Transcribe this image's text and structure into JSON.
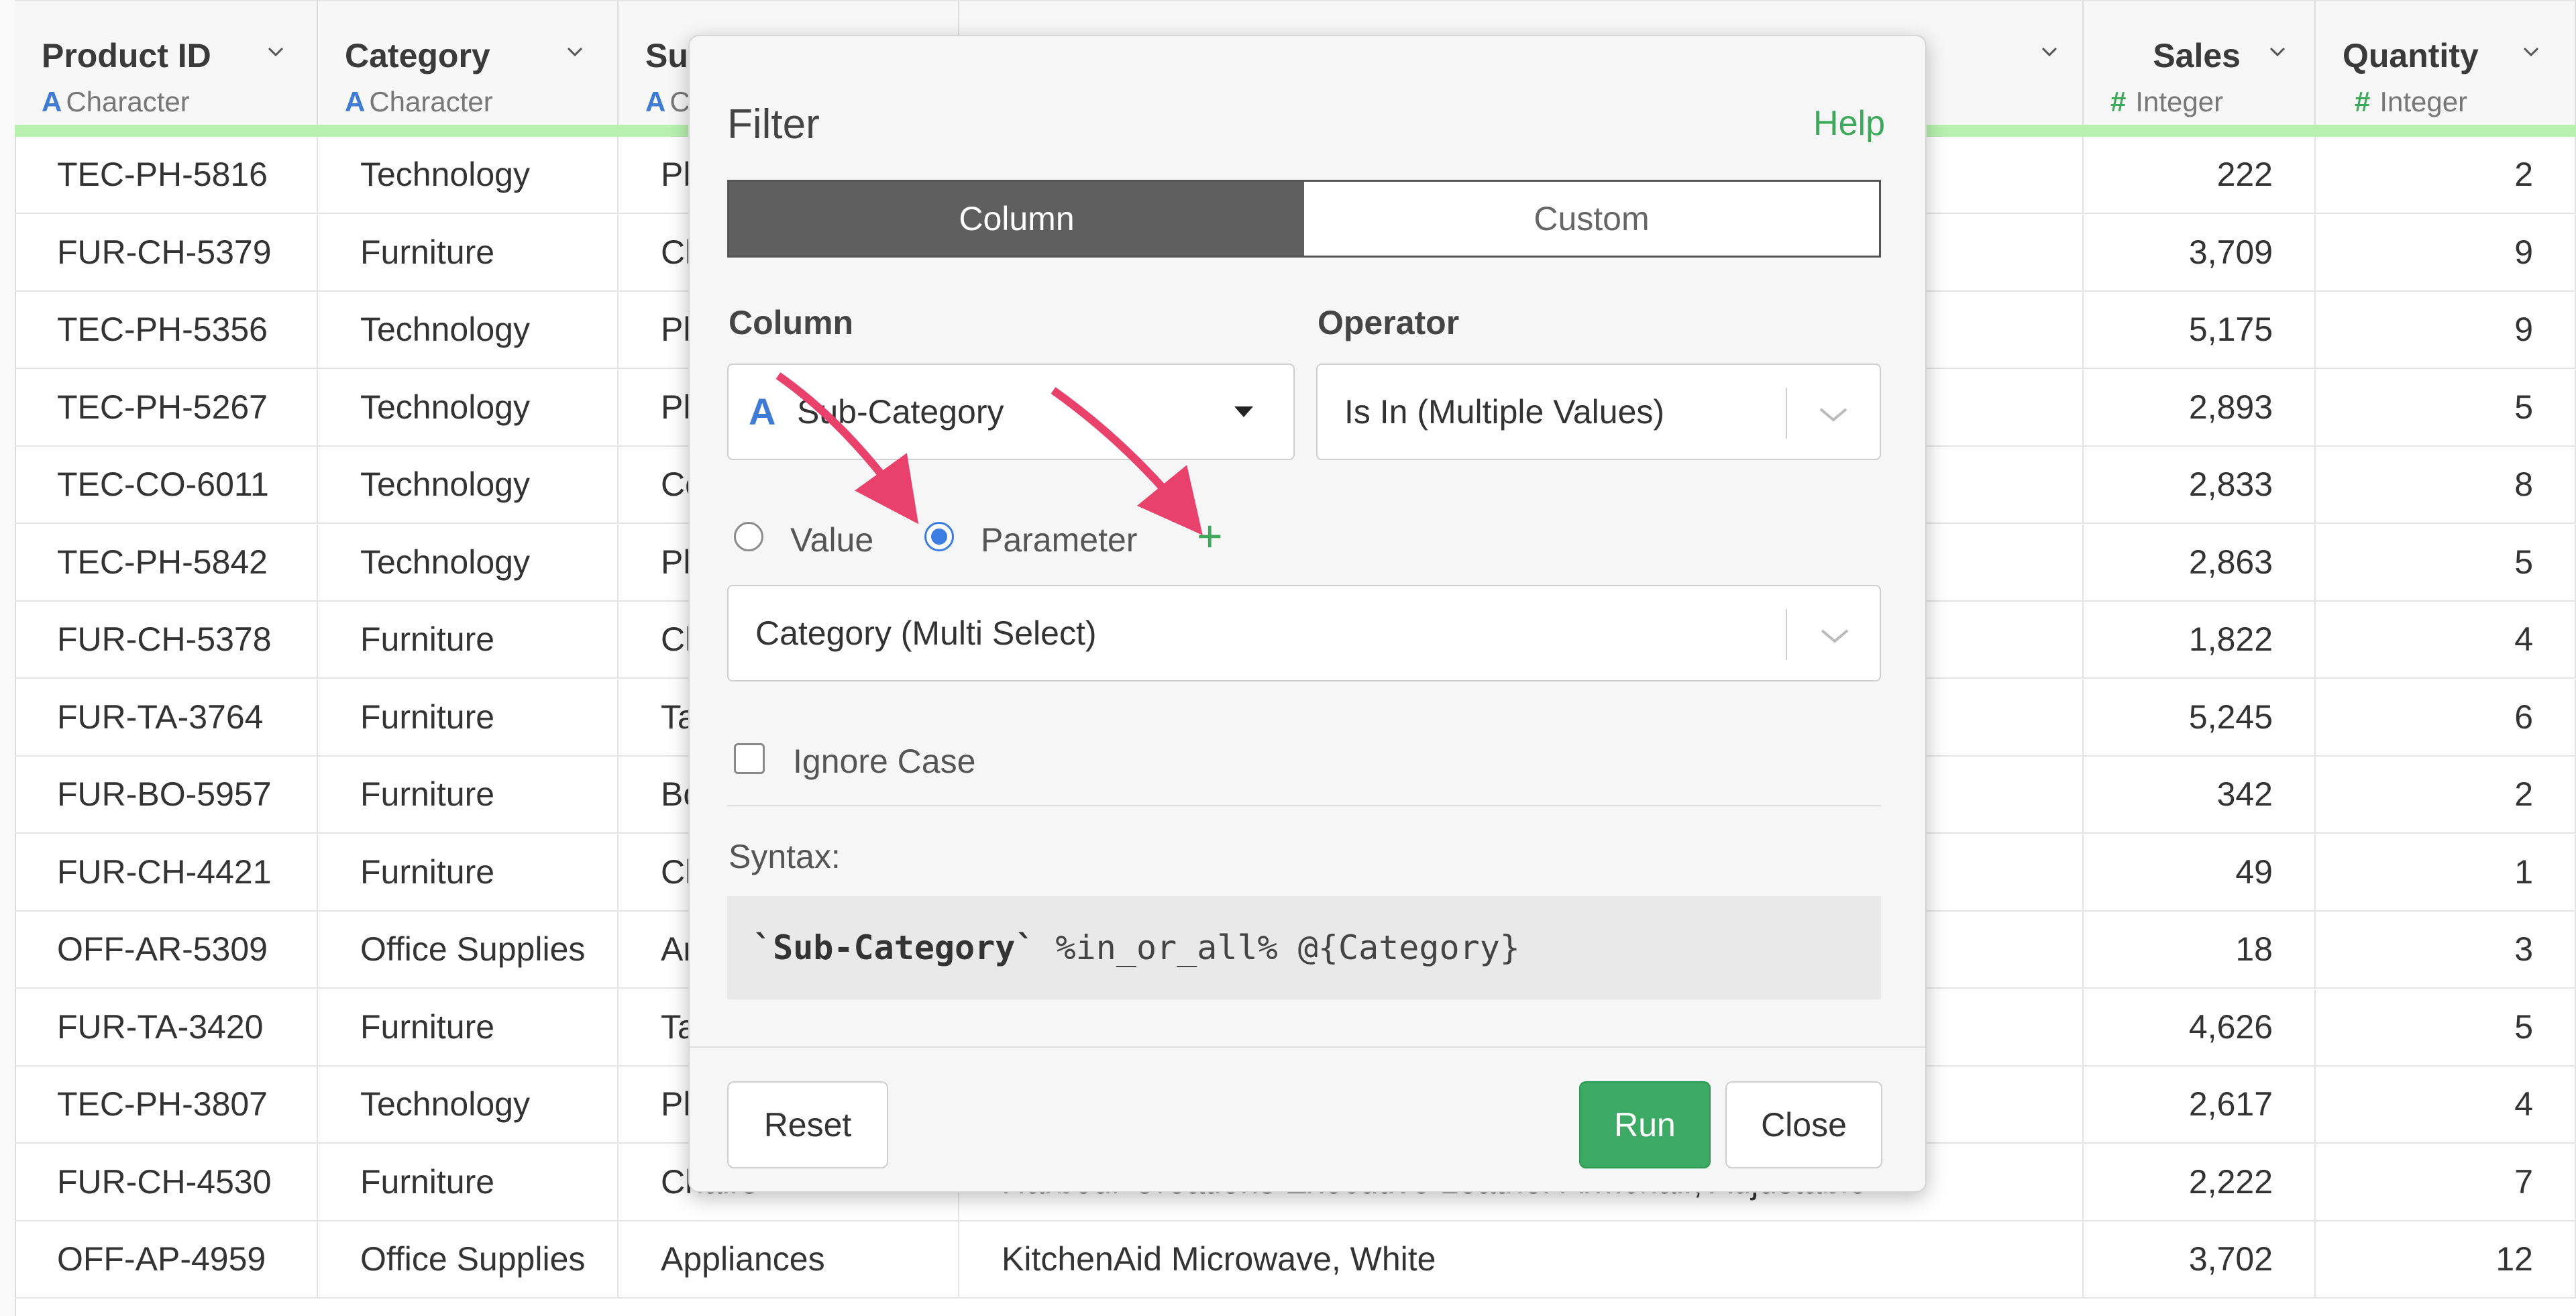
{
  "columns": [
    {
      "name": "Product ID",
      "type": "Character",
      "type_icon": "A",
      "align": "left"
    },
    {
      "name": "Category",
      "type": "Character",
      "type_icon": "A",
      "align": "left"
    },
    {
      "name": "Su",
      "type": "C",
      "type_icon": "A",
      "align": "left"
    },
    {
      "name": "",
      "type": "",
      "type_icon": "",
      "align": "left"
    },
    {
      "name": "Sales",
      "type": "Integer",
      "type_icon": "#",
      "align": "right"
    },
    {
      "name": "Quantity",
      "type": "Integer",
      "type_icon": "#",
      "align": "right"
    }
  ],
  "rows": [
    [
      "TEC-PH-5816",
      "Technology",
      "Ph",
      "",
      "222",
      "2"
    ],
    [
      "FUR-CH-5379",
      "Furniture",
      "Ch",
      "",
      "3,709",
      "9"
    ],
    [
      "TEC-PH-5356",
      "Technology",
      "Ph",
      "",
      "5,175",
      "9"
    ],
    [
      "TEC-PH-5267",
      "Technology",
      "Ph",
      "",
      "2,893",
      "5"
    ],
    [
      "TEC-CO-6011",
      "Technology",
      "Co",
      "",
      "2,833",
      "8"
    ],
    [
      "TEC-PH-5842",
      "Technology",
      "Ph",
      "",
      "2,863",
      "5"
    ],
    [
      "FUR-CH-5378",
      "Furniture",
      "Ch",
      "",
      "1,822",
      "4"
    ],
    [
      "FUR-TA-3764",
      "Furniture",
      "Tab",
      "",
      "5,245",
      "6"
    ],
    [
      "FUR-BO-5957",
      "Furniture",
      "Bo",
      "",
      "342",
      "2"
    ],
    [
      "FUR-CH-4421",
      "Furniture",
      "Ch",
      "",
      "49",
      "1"
    ],
    [
      "OFF-AR-5309",
      "Office Supplies",
      "Art",
      "",
      "18",
      "3"
    ],
    [
      "FUR-TA-3420",
      "Furniture",
      "Tab",
      "",
      "4,626",
      "5"
    ],
    [
      "TEC-PH-3807",
      "Technology",
      "Ph",
      "",
      "2,617",
      "4"
    ],
    [
      "FUR-CH-4530",
      "Furniture",
      "Chairs",
      "Harbour Creations Executive Leather Armchair, Adjustable",
      "2,222",
      "7"
    ],
    [
      "OFF-AP-4959",
      "Office Supplies",
      "Appliances",
      "KitchenAid Microwave, White",
      "3,702",
      "12"
    ]
  ],
  "dialog": {
    "title": "Filter",
    "help": "Help",
    "tabs": [
      "Column",
      "Custom"
    ],
    "active_tab": "Column",
    "column_label": "Column",
    "column_value": "Sub-Category",
    "operator_label": "Operator",
    "operator_value": "Is In (Multiple Values)",
    "radio_value_label": "Value",
    "radio_parameter_label": "Parameter",
    "selected_radio": "Parameter",
    "plus": "+",
    "parameter_value": "Category (Multi Select)",
    "ignore_case_label": "Ignore Case",
    "ignore_case_checked": false,
    "syntax_label": "Syntax:",
    "syntax_column": "`Sub-Category`",
    "syntax_rest": " %in_or_all% @{Category}",
    "reset": "Reset",
    "run": "Run",
    "close": "Close"
  },
  "colors": {
    "accent_green": "#3caa64",
    "radio_blue": "#3b7de0",
    "arrow_pink": "#e8416b",
    "header_bar": "#b8f0b0"
  }
}
